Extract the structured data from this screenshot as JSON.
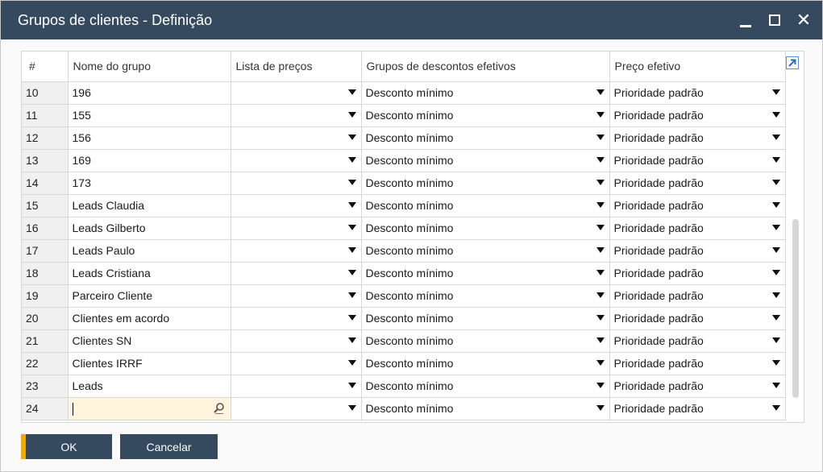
{
  "window": {
    "title": "Grupos de clientes - Definição",
    "colors": {
      "titlebar": "#354a5f",
      "accent": "#f0ab00",
      "active_cell": "#fff4dc"
    }
  },
  "grid": {
    "columns": [
      "#",
      "Nome do grupo",
      "Lista de preços",
      "Grupos de descontos efetivos",
      "Preço efetivo"
    ],
    "rows": [
      {
        "num": "10",
        "name": "196",
        "price_list": "",
        "discount": "Desconto mínimo",
        "effective_price": "Prioridade padrão"
      },
      {
        "num": "11",
        "name": "155",
        "price_list": "",
        "discount": "Desconto mínimo",
        "effective_price": "Prioridade padrão"
      },
      {
        "num": "12",
        "name": "156",
        "price_list": "",
        "discount": "Desconto mínimo",
        "effective_price": "Prioridade padrão"
      },
      {
        "num": "13",
        "name": "169",
        "price_list": "",
        "discount": "Desconto mínimo",
        "effective_price": "Prioridade padrão"
      },
      {
        "num": "14",
        "name": "173",
        "price_list": "",
        "discount": "Desconto mínimo",
        "effective_price": "Prioridade padrão"
      },
      {
        "num": "15",
        "name": "Leads Claudia",
        "price_list": "",
        "discount": "Desconto mínimo",
        "effective_price": "Prioridade padrão"
      },
      {
        "num": "16",
        "name": "Leads Gilberto",
        "price_list": "",
        "discount": "Desconto mínimo",
        "effective_price": "Prioridade padrão"
      },
      {
        "num": "17",
        "name": "Leads Paulo",
        "price_list": "",
        "discount": "Desconto mínimo",
        "effective_price": "Prioridade padrão"
      },
      {
        "num": "18",
        "name": "Leads Cristiana",
        "price_list": "",
        "discount": "Desconto mínimo",
        "effective_price": "Prioridade padrão"
      },
      {
        "num": "19",
        "name": "Parceiro Cliente",
        "price_list": "",
        "discount": "Desconto mínimo",
        "effective_price": "Prioridade padrão"
      },
      {
        "num": "20",
        "name": "Clientes em acordo",
        "price_list": "",
        "discount": "Desconto mínimo",
        "effective_price": "Prioridade padrão"
      },
      {
        "num": "21",
        "name": "Clientes SN",
        "price_list": "",
        "discount": "Desconto mínimo",
        "effective_price": "Prioridade padrão"
      },
      {
        "num": "22",
        "name": "Clientes IRRF",
        "price_list": "",
        "discount": "Desconto mínimo",
        "effective_price": "Prioridade padrão"
      },
      {
        "num": "23",
        "name": "Leads",
        "price_list": "",
        "discount": "Desconto mínimo",
        "effective_price": "Prioridade padrão"
      },
      {
        "num": "24",
        "name": "",
        "price_list": "",
        "discount": "Desconto mínimo",
        "effective_price": "Prioridade padrão",
        "active": true
      }
    ]
  },
  "buttons": {
    "ok": "OK",
    "cancel": "Cancelar"
  },
  "icons": {
    "minimize": "minimize-icon",
    "maximize": "maximize-icon",
    "close": "close-icon",
    "expand": "expand-arrow-icon",
    "dropdown": "dropdown-arrow-icon",
    "search": "search-icon"
  }
}
